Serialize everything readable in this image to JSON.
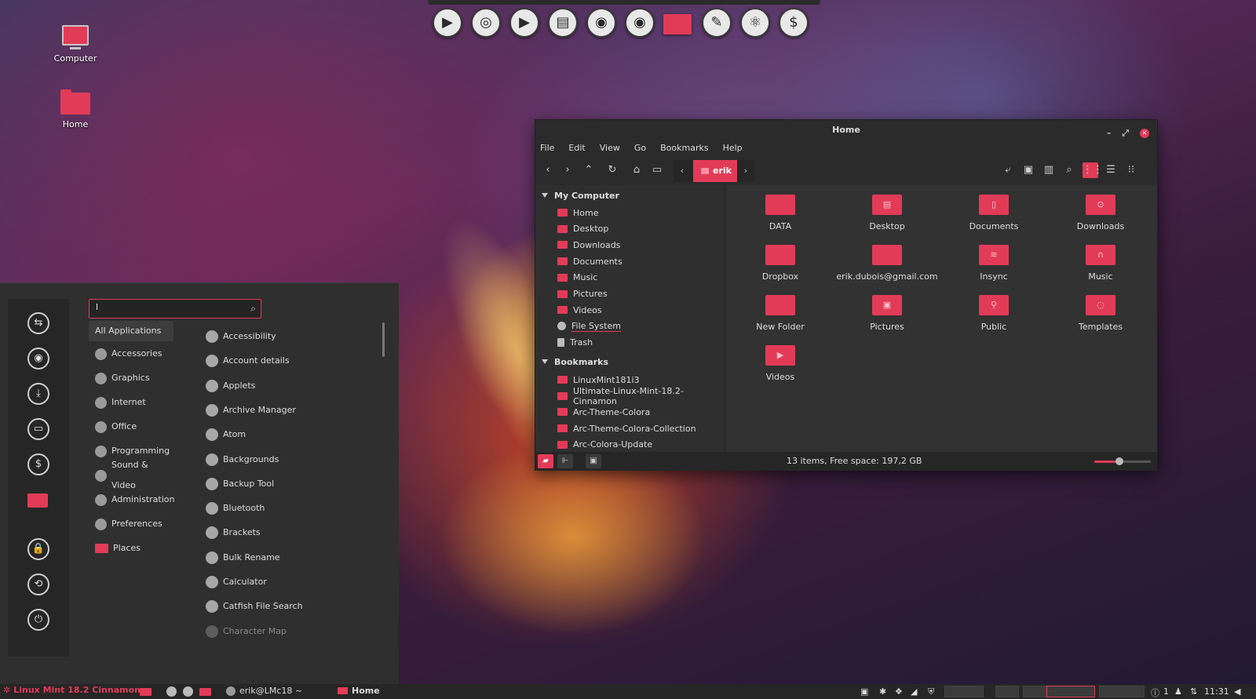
{
  "desktop": {
    "icons": [
      {
        "label": "Computer",
        "icon": "computer-icon"
      },
      {
        "label": "Home",
        "icon": "home-folder-icon"
      }
    ]
  },
  "dock": {
    "items": [
      "media-player-icon",
      "gimp-icon",
      "video-icon",
      "files-icon",
      "firefox-icon",
      "eye-icon",
      "folder-icon",
      "editor-icon",
      "atom-icon",
      "terminal-icon"
    ],
    "glyphs": [
      "▶",
      "◎",
      "▶",
      "▤",
      "◉",
      "◉",
      "",
      "✎",
      "⚛",
      "$"
    ]
  },
  "menu": {
    "search": {
      "value": "l",
      "placeholder": ""
    },
    "categories": [
      {
        "label": "All Applications",
        "active": true
      },
      {
        "label": "Accessories"
      },
      {
        "label": "Graphics"
      },
      {
        "label": "Internet"
      },
      {
        "label": "Office"
      },
      {
        "label": "Programming"
      },
      {
        "label": "Sound & Video"
      },
      {
        "label": "Administration"
      },
      {
        "label": "Preferences"
      },
      {
        "label": "Places"
      }
    ],
    "apps": [
      {
        "label": "Accessibility"
      },
      {
        "label": "Account details"
      },
      {
        "label": "Applets"
      },
      {
        "label": "Archive Manager"
      },
      {
        "label": "Atom"
      },
      {
        "label": "Backgrounds"
      },
      {
        "label": "Backup Tool"
      },
      {
        "label": "Bluetooth"
      },
      {
        "label": "Brackets"
      },
      {
        "label": "Bulk Rename"
      },
      {
        "label": "Calculator"
      },
      {
        "label": "Catfish File Search"
      },
      {
        "label": "Character Map"
      }
    ],
    "sidebar": [
      "connect-icon",
      "firefox-icon",
      "download-icon",
      "drive-icon",
      "terminal-icon",
      "folder-icon",
      "lock-icon",
      "logout-icon",
      "power-icon"
    ]
  },
  "filemanager": {
    "title": "Home",
    "menubar": [
      "File",
      "Edit",
      "View",
      "Go",
      "Bookmarks",
      "Help"
    ],
    "breadcrumb": "erik",
    "sidebar": {
      "my_computer": "My Computer",
      "places": [
        "Home",
        "Desktop",
        "Downloads",
        "Documents",
        "Music",
        "Pictures",
        "Videos",
        "File System",
        "Trash"
      ],
      "bookmarks": "Bookmarks",
      "bookmark_items": [
        "LinuxMint181i3",
        "Ultimate-Linux-Mint-18.2-Cinnamon",
        "Arc-Theme-Colora",
        "Arc-Theme-Colora-Collection",
        "Arc-Colora-Update"
      ]
    },
    "items": [
      {
        "label": "DATA",
        "glyph": ""
      },
      {
        "label": "Desktop",
        "glyph": "▤"
      },
      {
        "label": "Documents",
        "glyph": "▯"
      },
      {
        "label": "Downloads",
        "glyph": "⊙"
      },
      {
        "label": "Dropbox",
        "glyph": ""
      },
      {
        "label": "erik.dubois@gmail.com",
        "glyph": ""
      },
      {
        "label": "Insync",
        "glyph": "≋"
      },
      {
        "label": "Music",
        "glyph": "∩"
      },
      {
        "label": "New Folder",
        "glyph": ""
      },
      {
        "label": "Pictures",
        "glyph": "▣"
      },
      {
        "label": "Public",
        "glyph": "⚲"
      },
      {
        "label": "Templates",
        "glyph": "◌"
      },
      {
        "label": "Videos",
        "glyph": "▶"
      }
    ],
    "status": "13 items, Free space: 197,2 GB",
    "zoom_fraction": 0.45
  },
  "taskbar": {
    "start_label": "Linux Mint 18.2 Cinnamon",
    "tasks": [
      "erik@LMc18 ~",
      "Home"
    ],
    "clock": "11:31",
    "user_count": "1"
  },
  "colors": {
    "accent": "#e23b58",
    "panel": "#262626",
    "window": "#2b2b2b"
  }
}
